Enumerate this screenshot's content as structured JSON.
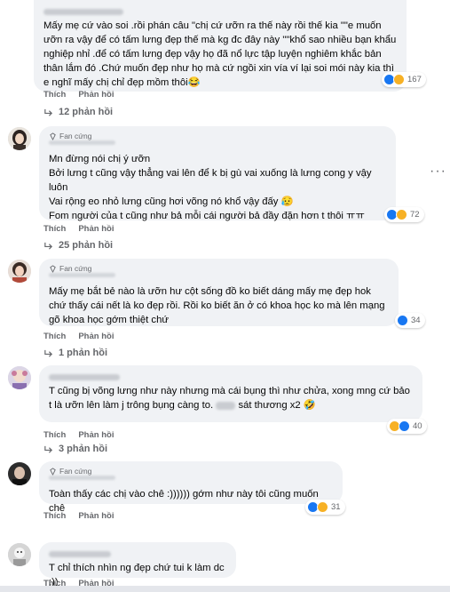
{
  "actions": {
    "like": "Thích",
    "reply": "Phản hồi"
  },
  "badge_label": "Fan cứng",
  "comments": [
    {
      "text": "Mấy mẹ cứ vào soi .rồi phán câu \"chị cứ ưỡn ra thế này rồi thế kia \"\"e muốn ưỡn ra vậy để có tấm lưng đẹp thế mà kg đc đây này \"\"khổ sao nhiều bạn khẩu nghiệp nhỉ .để có tấm lưng đẹp vậy họ đã nổ lực tập luyện nghiêm khắc bản thân lắm đó .Chứ muốn đẹp như họ mà cứ ngồi xin vía ví lại soi mói này kia thì e nghĩ mấy chị chỉ đẹp mồm thôi😂",
      "reactions_count": "167",
      "replies_label": "12 phản hồi"
    },
    {
      "text": "Mn đừng nói chị ý ưỡn\nBởi lưng t cũng vậy thẳng vai lên để k bị gù vai xuống là lưng cong y vậy luôn\nVai rộng eo nhỏ lưng cũng hơi võng nó khổ vậy đấy 😥\nFom người của t cũng như bả mỗi cái người bả đầy đặn hơn t thôi ㅠㅠ",
      "reactions_count": "72",
      "replies_label": "25 phản hồi"
    },
    {
      "text": "Mấy mẹ bắt bẻ nào là ưỡn hư cột sống đồ ko biết dáng mấy mẹ đẹp hok chứ thấy cái nết là ko đẹp rồi. Rồi ko biết ăn ở có khoa học ko mà lên mạng gõ khoa học gớm thiệt chứ",
      "reactions_count": "34",
      "replies_label": "1 phản hồi"
    },
    {
      "text_a": "T cũng bị võng lưng như này nhưng mà cái bụng thì như chửa, xong mng cứ bảo t là ưỡn lên làm j trông bụng càng to.",
      "text_b": "sát thương x2 🤣",
      "reactions_count": "40",
      "replies_label": "3 phản hồi"
    },
    {
      "text": "Toàn thấy các chị vào chê :)))))) gớm như này tôi cũng muốn chê",
      "reactions_count": "31"
    },
    {
      "text": "T chỉ thích nhìn ng đẹp chứ tui k làm dc ;))"
    }
  ],
  "colors": {
    "bubble": "#f0f2f5",
    "like": "#1877f2",
    "haha": "#f7b125",
    "muted": "#65676b"
  }
}
